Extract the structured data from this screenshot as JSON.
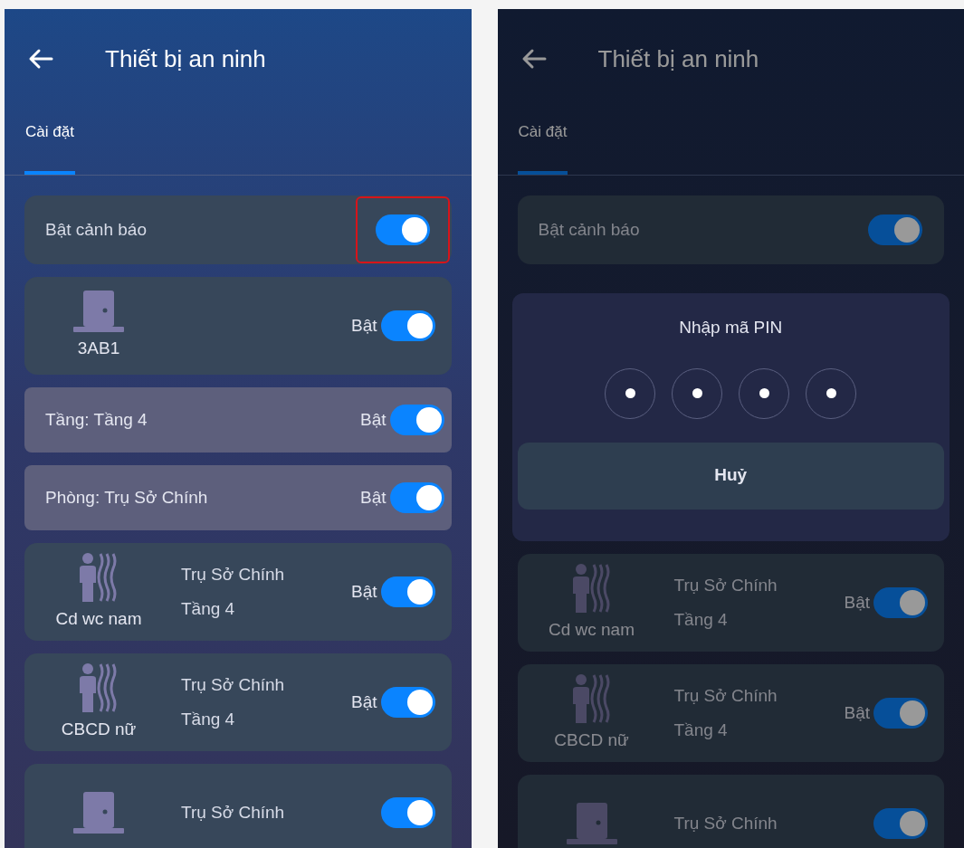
{
  "screens": [
    {
      "title": "Thiết bị an ninh",
      "dimmed": false,
      "tabs": [
        {
          "label": "Cài đặt",
          "selected": true
        }
      ],
      "items": [
        {
          "kind": "alarm",
          "label": "Bật cảnh báo",
          "on": true,
          "highlighted": true
        },
        {
          "kind": "door",
          "name": "3AB1",
          "status": "Bật",
          "on": true
        },
        {
          "kind": "filter",
          "label": "Tầng: Tầng 4",
          "status": "Bật",
          "on": true
        },
        {
          "kind": "filter",
          "label": "Phòng: Trụ Sở Chính",
          "status": "Bật",
          "on": true
        },
        {
          "kind": "motion_sensor",
          "name": "Cd wc nam",
          "location": [
            "Trụ Sở Chính",
            "Tầng 4"
          ],
          "status": "Bật",
          "on": true
        },
        {
          "kind": "motion_sensor",
          "name": "CBCD nữ",
          "location": [
            "Trụ Sở Chính",
            "Tầng 4"
          ],
          "status": "Bật",
          "on": true
        },
        {
          "kind": "door",
          "location": [
            "Trụ Sở Chính"
          ],
          "on": true
        }
      ]
    },
    {
      "title": "Thiết bị an ninh",
      "dimmed": true,
      "tabs": [
        {
          "label": "Cài đặt",
          "selected": true
        }
      ],
      "items": [
        {
          "kind": "alarm",
          "label": "Bật cảnh báo",
          "on": true,
          "highlighted": false
        },
        {
          "kind": "pin_dialog",
          "title": "Nhập mã PIN",
          "pin": [
            {
              "filled": true
            },
            {
              "filled": true
            },
            {
              "filled": true
            },
            {
              "filled": true
            }
          ],
          "button": "Huỷ"
        },
        {
          "kind": "motion_sensor",
          "name": "Cd wc nam",
          "location": [
            "Trụ Sở Chính",
            "Tầng 4"
          ],
          "status": "Bật",
          "on": true
        },
        {
          "kind": "motion_sensor",
          "name": "CBCD nữ",
          "location": [
            "Trụ Sở Chính",
            "Tầng 4"
          ],
          "status": "Bật",
          "on": true
        },
        {
          "kind": "door",
          "location": [
            "Trụ Sở Chính"
          ],
          "on": true
        }
      ]
    }
  ]
}
